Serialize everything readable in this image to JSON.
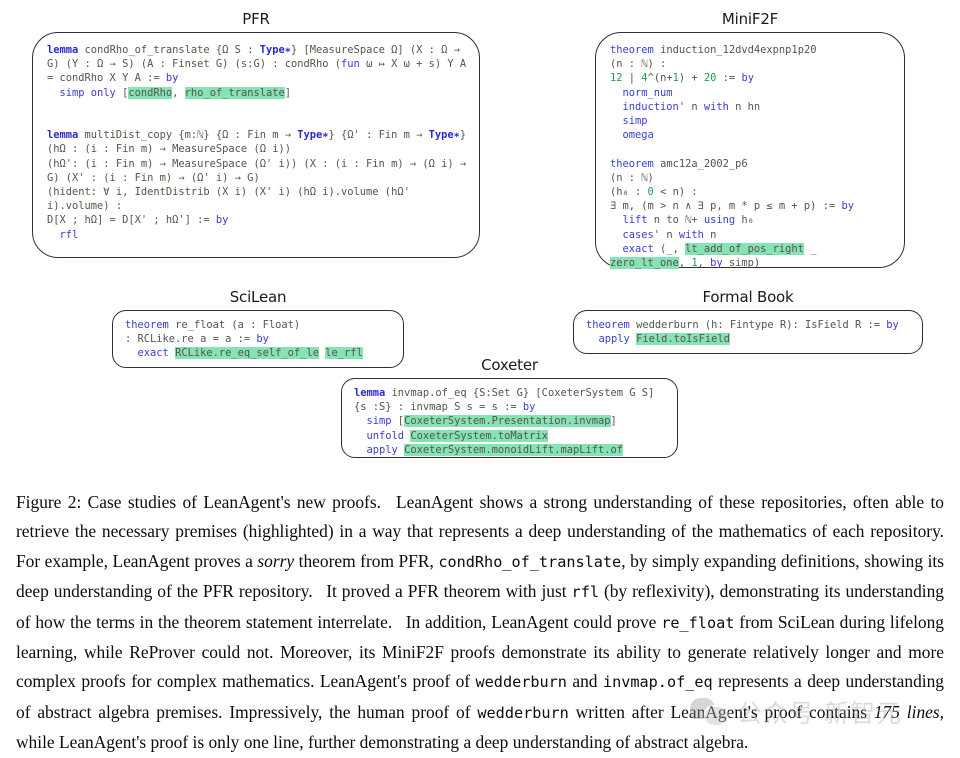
{
  "figure": {
    "panels": [
      {
        "id": "pfr",
        "title": "PFR",
        "code_html": "<span class=\"kw2\">lemma</span> <span class=\"id\">condRho_of_translate {Ω S : </span><span class=\"kw2\">Type∗</span><span class=\"id\">} [MeasureSpace Ω] (X : Ω → G) (Y : Ω → S) (A : Finset G) (s:G) : condRho (</span><span class=\"kw\">fun</span><span class=\"id\"> ω ↦ X ω + s) Y A = condRho X Y A := </span><span class=\"kw\">by</span>\n  <span class=\"kw\">simp only</span> <span class=\"id\">[</span><span class=\"hl id\">condRho</span><span class=\"id\">, </span><span class=\"hl id\">rho_of_translate</span><span class=\"id\">]</span>\n\n\n<span class=\"kw2\">lemma</span> <span class=\"id\">multiDist_copy {m:ℕ} {Ω : Fin m → </span><span class=\"kw2\">Type∗</span><span class=\"id\">} {Ω' : Fin m → </span><span class=\"kw2\">Type∗</span><span class=\"id\">} (hΩ : (i : Fin m) → MeasureSpace (Ω i))\n(hΩ': (i : Fin m) → MeasureSpace (Ω' i)) (X : (i : Fin m) → (Ω i) → G) (X' : (i : Fin m) → (Ω' i) → G)\n(hident: ∀ i, IdentDistrib (X i) (X' i) (hΩ i).volume (hΩ' i).volume) :\nD[X ; hΩ] = D[X' ; hΩ'] := </span><span class=\"kw\">by</span>\n  <span class=\"kw\">rfl</span>"
      },
      {
        "id": "minif2f",
        "title": "MiniF2F",
        "code_html": "<span class=\"kw\">theorem</span> <span class=\"id\">induction_12dvd4expnp1p20</span>\n<span class=\"id\">(n : ℕ) :</span>\n<span class=\"num\">12</span> <span class=\"id\">| </span><span class=\"num\">4</span><span class=\"id\">^(n+</span><span class=\"num\">1</span><span class=\"id\">) + </span><span class=\"num\">20</span> <span class=\"id\">:= </span><span class=\"kw\">by</span>\n  <span class=\"kw\">norm_num</span>\n  <span class=\"kw\">induction'</span><span class=\"id\"> n </span><span class=\"kw\">with</span><span class=\"id\"> n hn</span>\n  <span class=\"kw\">simp</span>\n  <span class=\"kw\">omega</span>\n\n<span class=\"kw\">theorem</span> <span class=\"id\">amc12a_2002_p6</span>\n<span class=\"id\">(n : ℕ)</span>\n<span class=\"id\">(h₀ : </span><span class=\"num\">0</span><span class=\"id\"> &lt; n) :</span>\n<span class=\"id\">∃ m, (m &gt; n ∧ ∃ p, m * p ≤ m + p) := </span><span class=\"kw\">by</span>\n  <span class=\"kw\">lift</span><span class=\"id\"> n to ℕ+ </span><span class=\"kw\">using</span><span class=\"id\"> h₀</span>\n  <span class=\"kw\">cases'</span><span class=\"id\"> n </span><span class=\"kw\">with</span><span class=\"id\"> n</span>\n  <span class=\"kw\">exact</span><span class=\"id\"> (_, </span><span class=\"hl id\">lt_add_of_pos_right</span><span class=\"id\"> _ </span><span class=\"hl id\">zero_lt_one</span><span class=\"id\">, </span><span class=\"num\">1</span><span class=\"id\">, </span><span class=\"kw\">by</span><span class=\"id\"> simp)</span>"
      },
      {
        "id": "scilean",
        "title": "SciLean",
        "code_html": "<span class=\"kw\">theorem</span> <span class=\"id\">re_float (a : Float)</span>\n<span class=\"id\">: RCLike.re a = a := </span><span class=\"kw\">by</span>\n  <span class=\"kw\">exact</span> <span class=\"hl id\">RCLike.re_eq_self_of_le</span><span class=\"id\"> </span><span class=\"hl id\">le_rfl</span>"
      },
      {
        "id": "formal-book",
        "title": "Formal Book",
        "code_html": "<span class=\"kw\">theorem</span> <span class=\"id\">wedderburn (h: Fintype R): IsField R := </span><span class=\"kw\">by</span>\n  <span class=\"kw\">apply</span> <span class=\"hl id\">Field.toIsField</span>"
      },
      {
        "id": "coxeter",
        "title": "Coxeter",
        "code_html": "<span class=\"kw2\">lemma</span> <span class=\"id\">invmap.of_eq {S:Set G} [CoxeterSystem G S] {s :S} : invmap S s = s := </span><span class=\"kw\">by</span>\n  <span class=\"kw\">simp</span><span class=\"id\"> [</span><span class=\"hl id\">CoxeterSystem.Presentation.invmap</span><span class=\"id\">]</span>\n  <span class=\"kw\">unfold</span> <span class=\"hl id\">CoxeterSystem.toMatrix</span>\n  <span class=\"kw\">apply</span> <span class=\"hl id\">CoxeterSystem.monoidLift.mapLift.of</span>"
      }
    ]
  },
  "caption": {
    "html": "Figure 2: Case studies of LeanAgent's new proofs.  LeanAgent shows a strong understanding of these repositories, often able to retrieve the necessary premises (highlighted) in a way that represents a deep understanding of the mathematics of each repository. For example, LeanAgent proves a <span class=\"it\">sorry</span> theorem from PFR, <span class=\"mono\">condRho_of_translate</span>, by simply expanding definitions, showing its deep understanding of the PFR repository.  It proved a PFR theorem with just <span class=\"mono\">rfl</span> (by reflexivity), demonstrating its understanding of how the terms in the theorem statement interrelate.  In addition, LeanAgent could prove <span class=\"mono\">re_float</span> from SciLean during lifelong learning, while ReProver could not. Moreover, its MiniF2F proofs demonstrate its ability to generate relatively longer and more complex proofs for complex mathematics. LeanAgent's proof of <span class=\"mono\">wedderburn</span> and <span class=\"mono\">invmap.of_eq</span> represents a deep understanding of abstract algebra premises. Impressively, the human proof of <span class=\"mono\">wedderburn</span> written after LeanAgent's proof contains <span class=\"it\">175 lines</span>, while LeanAgent's proof is only one line, further demonstrating a deep understanding of abstract algebra."
  },
  "watermark": {
    "text": "公众号 新智元"
  },
  "colors": {
    "highlight": "#86e3b5",
    "keyword": "#3b3bd6",
    "number": "#1f9d55",
    "identifier": "#55554a",
    "border": "#2b2f44"
  }
}
